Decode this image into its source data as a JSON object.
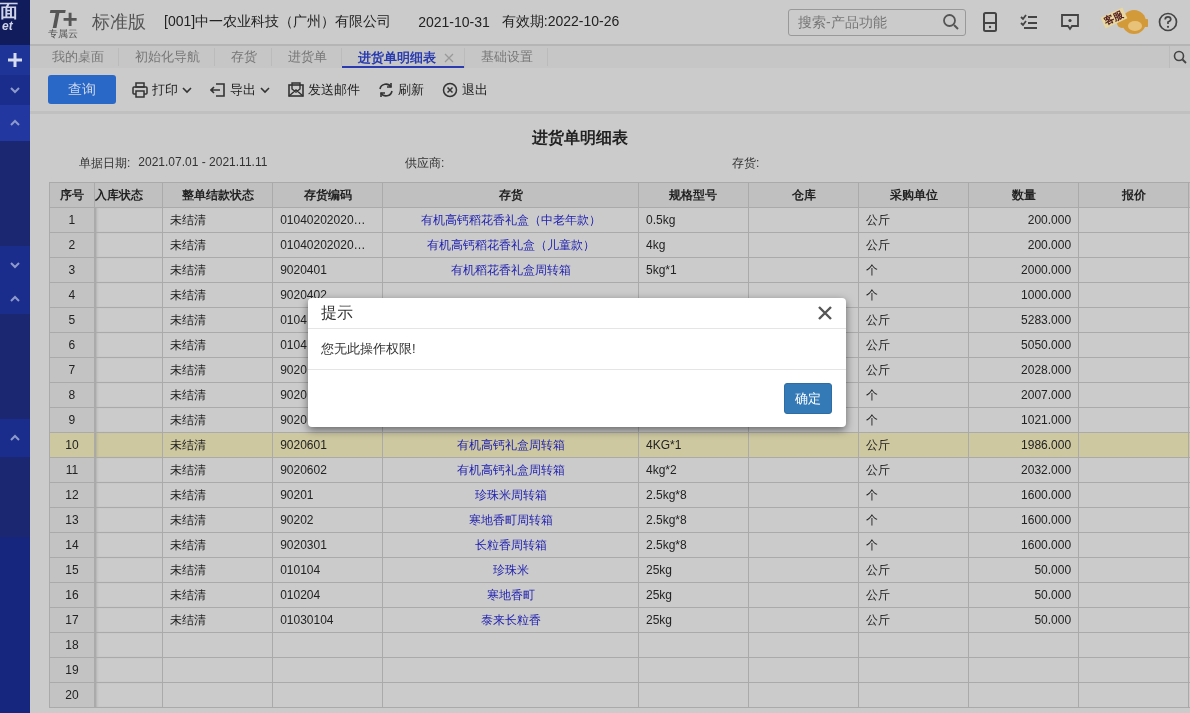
{
  "sidebar": {
    "logo_lines": [
      "面",
      "et"
    ],
    "items": [
      {
        "kind": "plus"
      },
      {
        "kind": "down"
      },
      {
        "kind": "up",
        "selected": true
      },
      {
        "kind": "gap"
      },
      {
        "kind": "down"
      },
      {
        "kind": "up"
      },
      {
        "kind": "gap"
      },
      {
        "kind": "up"
      }
    ]
  },
  "header": {
    "logo": "T+",
    "logo_sub": "专属云",
    "edition": "标准版",
    "company": "[001]中一农业科技（广州）有限公司",
    "date": "2021-10-31",
    "valid": "有效期:2022-10-26",
    "search": {
      "placeholder": "搜索-产品功能"
    },
    "service_badge": "客服"
  },
  "tabs": [
    {
      "label": "我的桌面",
      "selected": false
    },
    {
      "label": "初始化导航",
      "selected": false
    },
    {
      "label": "存货",
      "selected": false
    },
    {
      "label": "进货单",
      "selected": false
    },
    {
      "label": "进货单明细表",
      "selected": true,
      "closable": true
    },
    {
      "label": "基础设置",
      "selected": false
    }
  ],
  "toolbar": [
    {
      "kind": "primary",
      "label": "查询"
    },
    {
      "kind": "print",
      "label": "打印",
      "dropdown": true
    },
    {
      "kind": "export",
      "label": "导出",
      "dropdown": true
    },
    {
      "kind": "mail",
      "label": "发送邮件"
    },
    {
      "kind": "refresh",
      "label": "刷新"
    },
    {
      "kind": "exit",
      "label": "退出"
    }
  ],
  "report": {
    "title": "进货单明细表",
    "filters": [
      {
        "label": "单据日期:",
        "value": "2021.07.01 - 2021.11.11"
      },
      {
        "label": "供应商:"
      },
      {
        "label": "存货:"
      }
    ]
  },
  "table": {
    "columns": [
      "序号",
      "入库状态",
      "整单结款状态",
      "存货编码",
      "存货",
      "规格型号",
      "仓库",
      "采购单位",
      "数量",
      "报价"
    ],
    "rows": [
      {
        "seq": "1",
        "settle": "未结清",
        "code": "01040202020…",
        "item": "有机高钙稻花香礼盒（中老年款）",
        "spec": "0.5kg",
        "unit": "公斤",
        "qty": "200.000",
        "selected": false
      },
      {
        "seq": "2",
        "settle": "未结清",
        "code": "01040202020…",
        "item": "有机高钙稻花香礼盒（儿童款）",
        "spec": "4kg",
        "unit": "公斤",
        "qty": "200.000",
        "selected": false
      },
      {
        "seq": "3",
        "settle": "未结清",
        "code": "9020401",
        "item": "有机稻花香礼盒周转箱",
        "spec": "5kg*1",
        "unit": "个",
        "qty": "2000.000",
        "selected": false
      },
      {
        "seq": "4",
        "settle": "未结清",
        "code": "9020402",
        "unit": "个",
        "qty": "1000.000",
        "selected": false
      },
      {
        "seq": "5",
        "settle": "未结清",
        "code": "0104",
        "unit": "公斤",
        "qty": "5283.000",
        "selected": false
      },
      {
        "seq": "6",
        "settle": "未结清",
        "code": "0104",
        "unit": "公斤",
        "qty": "5050.000",
        "selected": false
      },
      {
        "seq": "7",
        "settle": "未结清",
        "code": "9020",
        "unit": "公斤",
        "qty": "2028.000",
        "selected": false
      },
      {
        "seq": "8",
        "settle": "未结清",
        "code": "9020",
        "unit": "个",
        "qty": "2007.000",
        "selected": false
      },
      {
        "seq": "9",
        "settle": "未结清",
        "code": "9020",
        "unit": "个",
        "qty": "1021.000",
        "selected": false
      },
      {
        "seq": "10",
        "settle": "未结清",
        "code": "9020601",
        "item": "有机高钙礼盒周转箱",
        "spec": "4KG*1",
        "unit": "公斤",
        "qty": "1986.000",
        "selected": true
      },
      {
        "seq": "11",
        "settle": "未结清",
        "code": "9020602",
        "item": "有机高钙礼盒周转箱",
        "spec": "4kg*2",
        "unit": "公斤",
        "qty": "2032.000",
        "selected": false
      },
      {
        "seq": "12",
        "settle": "未结清",
        "code": "90201",
        "item": "珍珠米周转箱",
        "spec": "2.5kg*8",
        "unit": "个",
        "qty": "1600.000",
        "selected": false
      },
      {
        "seq": "13",
        "settle": "未结清",
        "code": "90202",
        "item": "寒地香町周转箱",
        "spec": "2.5kg*8",
        "unit": "个",
        "qty": "1600.000",
        "selected": false
      },
      {
        "seq": "14",
        "settle": "未结清",
        "code": "9020301",
        "item": "长粒香周转箱",
        "spec": "2.5kg*8",
        "unit": "个",
        "qty": "1600.000",
        "selected": false
      },
      {
        "seq": "15",
        "settle": "未结清",
        "code": "010104",
        "item": "珍珠米",
        "spec": "25kg",
        "unit": "公斤",
        "qty": "50.000",
        "selected": false
      },
      {
        "seq": "16",
        "settle": "未结清",
        "code": "010204",
        "item": "寒地香町",
        "spec": "25kg",
        "unit": "公斤",
        "qty": "50.000",
        "selected": false
      },
      {
        "seq": "17",
        "settle": "未结清",
        "code": "01030104",
        "item": "泰来长粒香",
        "spec": "25kg",
        "unit": "公斤",
        "qty": "50.000",
        "selected": false
      },
      {
        "seq": "18",
        "selected": false
      },
      {
        "seq": "19",
        "selected": false
      },
      {
        "seq": "20",
        "selected": false
      }
    ]
  },
  "dialog": {
    "title": "提示",
    "message": "您无此操作权限!",
    "button": "确定"
  }
}
